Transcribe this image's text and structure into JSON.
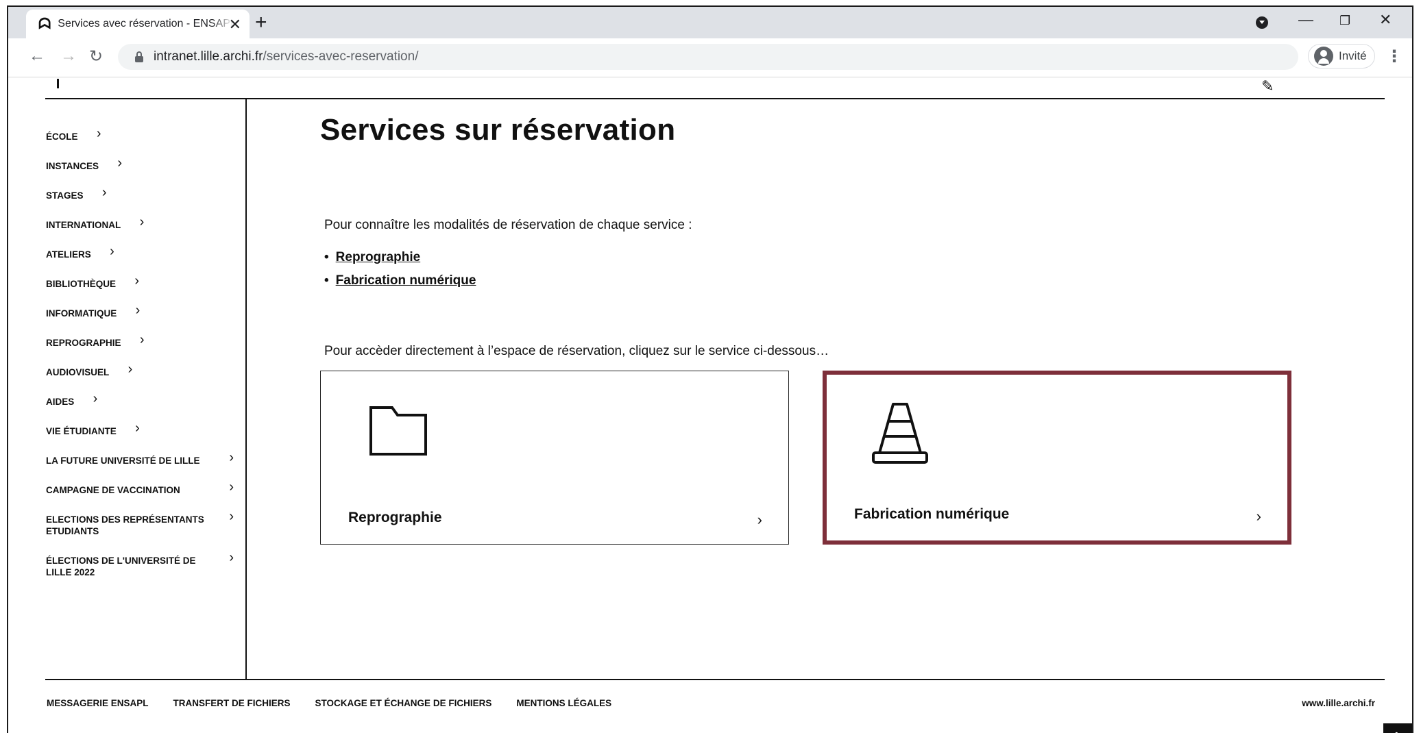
{
  "browser": {
    "tab_title": "Services avec réservation - ENSAPL",
    "favicon": "ensapl-logo-icon",
    "url_host": "intranet.lille.archi.fr",
    "url_path": "/services-avec-reservation/",
    "profile_label": "Invité"
  },
  "sidebar": {
    "items": [
      {
        "label": "ÉCOLE"
      },
      {
        "label": "INSTANCES"
      },
      {
        "label": "STAGES"
      },
      {
        "label": "INTERNATIONAL"
      },
      {
        "label": "ATELIERS"
      },
      {
        "label": "BIBLIOTHÈQUE"
      },
      {
        "label": "INFORMATIQUE"
      },
      {
        "label": "REPROGRAPHIE"
      },
      {
        "label": "AUDIOVISUEL"
      },
      {
        "label": "AIDES"
      },
      {
        "label": "VIE ÉTUDIANTE"
      },
      {
        "label": "LA FUTURE UNIVERSITÉ DE LILLE"
      },
      {
        "label": "CAMPAGNE DE VACCINATION"
      },
      {
        "label": "ELECTIONS DES REPRÉSENTANTS ETUDIANTS"
      },
      {
        "label": "ÉLECTIONS DE L'UNIVERSITÉ DE LILLE 2022"
      }
    ]
  },
  "main": {
    "title": "Services sur réservation",
    "intro_modalities": "Pour connaître les modalités de réservation de chaque service :",
    "links": [
      "Reprographie",
      "Fabrication numérique"
    ],
    "intro_direct": "Pour accèder directement à l’espace de réservation, cliquez sur le service ci-dessous…",
    "cards": [
      {
        "label": "Reprographie",
        "icon": "folder-icon",
        "selected": false
      },
      {
        "label": "Fabrication numérique",
        "icon": "traffic-cone-icon",
        "selected": true
      }
    ],
    "selected_card_color": "#7e2f3a"
  },
  "footer": {
    "links": [
      "MESSAGERIE ENSAPL",
      "TRANSFERT DE FICHIERS",
      "STOCKAGE ET ÉCHANGE DE FICHIERS",
      "MENTIONS LÉGALES"
    ],
    "site": "www.lille.archi.fr"
  }
}
